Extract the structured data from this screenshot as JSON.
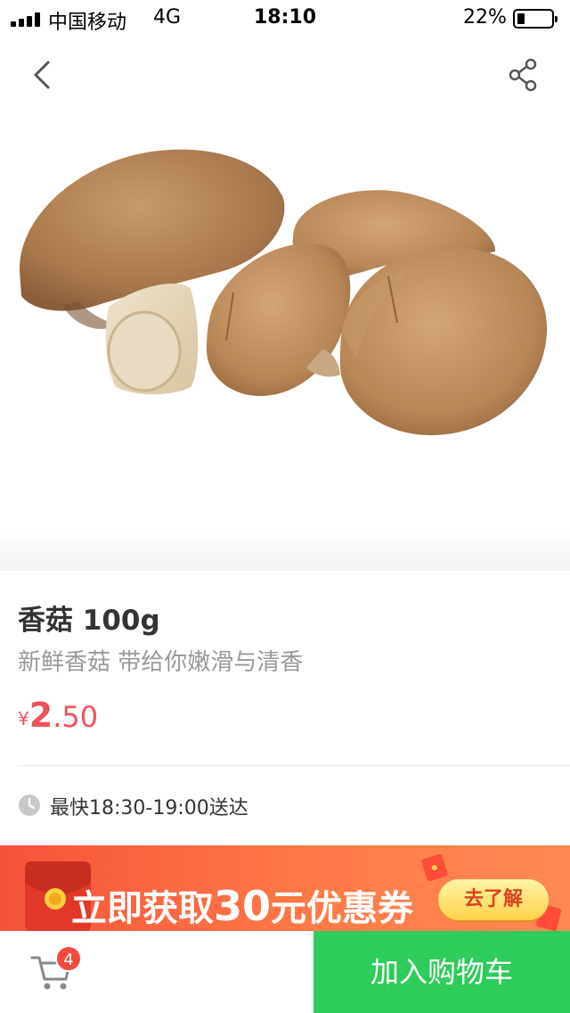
{
  "status_bar": {
    "carrier": "中国移动",
    "network": "4G",
    "time": "18:10",
    "battery": "22%",
    "battery_level": 0.22
  },
  "nav": {
    "back_icon": "chevron-left-icon",
    "share_icon": "share-icon"
  },
  "product": {
    "image": "shiitake-mushrooms-photo",
    "title": "香菇 100g",
    "subtitle": "新鲜香菇 带给你嫩滑与清香",
    "price": {
      "currency": "¥",
      "integer": "2",
      "decimal": ".50"
    }
  },
  "delivery": {
    "icon": "clock-icon",
    "text": "最快18:30-19:00送达"
  },
  "coupon_banner": {
    "prefix": "立即获取",
    "amount": "30",
    "suffix": "元优惠券",
    "button_label": "去了解"
  },
  "bottom_bar": {
    "cart_icon": "shopping-cart-icon",
    "cart_count": "4",
    "add_to_cart_label": "加入购物车"
  },
  "colors": {
    "price": "#f0525a",
    "add_to_cart_bg": "#2ecc5a",
    "badge": "#f44a3f",
    "banner": "#f6533a"
  }
}
